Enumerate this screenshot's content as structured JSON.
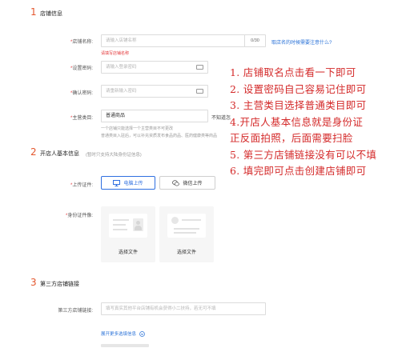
{
  "section1": {
    "number": "1",
    "title": "店铺信息",
    "store_name": {
      "label": "店铺名称:",
      "placeholder": "请输入店铺名称",
      "counter": "0/30",
      "help_link": "取店名的时候需要注意什么?",
      "error": "请填写店铺名称"
    },
    "set_password": {
      "label": "设置密码:",
      "placeholder": "请输入登录密码"
    },
    "confirm_password": {
      "label": "确认密码:",
      "placeholder": "请重新输入密码"
    },
    "category": {
      "label": "主营类目:",
      "value": "普通商品",
      "side_text": "不知道怎",
      "hint1": "一个店铺只能选择一个主营类目不可更改",
      "hint2": "普通类目入驻后，可以补充资质发布食品药品、医药健康类等商品"
    }
  },
  "section2": {
    "number": "2",
    "title": "开店人基本信息",
    "subtitle": "(暂时只支持大陆身份证信息)",
    "upload_label": "上传证件:",
    "upload_pc": "电脑上传",
    "upload_wechat": "微信上传",
    "id_label": "身份证件像:",
    "choose_file_1": "选择文件",
    "choose_file_2": "选择文件"
  },
  "section3": {
    "number": "3",
    "title": "第三方店铺链接",
    "link_label": "第三方店铺链接:",
    "link_placeholder": "填写真实其他平台店铺有机会获得小二扶持，若无可不填",
    "expand": "展开更多选填信息"
  },
  "annotations": [
    "1. 店铺取名点击看一下即可",
    "2. 设置密码自己容易记住即可",
    "3. 主营类目选择普通类目即可",
    "4.开店人基本信息就是身份证",
    "正反面拍照，后面需要扫脸",
    "5. 第三方店铺链接没有可以不填",
    "6. 填完即可点击创建店铺即可"
  ],
  "colors": {
    "section_number": "#e4572e",
    "annotation": "#d42a2a",
    "link": "#2b73d8",
    "error": "#e4393c",
    "active_button": "#2f6fe0"
  }
}
